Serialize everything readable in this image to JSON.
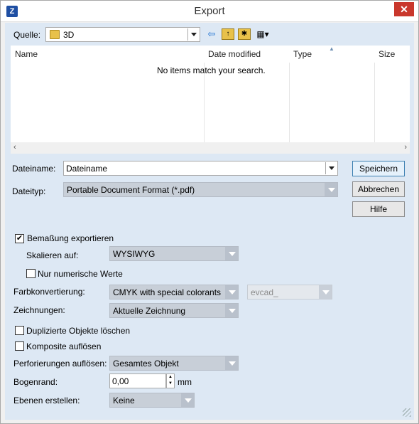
{
  "window": {
    "title": "Export",
    "close_label": "✕"
  },
  "location": {
    "label": "Quelle:",
    "value": "3D"
  },
  "listview": {
    "columns": [
      "Name",
      "Date modified",
      "Type",
      "Size"
    ],
    "empty_message": "No items match your search."
  },
  "file": {
    "name_label": "Dateiname:",
    "name_value": "Dateiname",
    "type_label": "Dateityp:",
    "type_value": "Portable Document Format (*.pdf)"
  },
  "buttons": {
    "save": "Speichern",
    "cancel": "Abbrechen",
    "help": "Hilfe"
  },
  "options": {
    "export_dimensions": {
      "label": "Bemaßung exportieren",
      "checked": true
    },
    "scale": {
      "label": "Skalieren auf:",
      "value": "WYSIWYG"
    },
    "numeric_only": {
      "label": "Nur numerische Werte",
      "checked": false
    },
    "color_conversion": {
      "label": "Farbkonvertierung:",
      "value": "CMYK with special colorants",
      "profile": "evcad_"
    },
    "drawings": {
      "label": "Zeichnungen:",
      "value": "Aktuelle Zeichnung"
    },
    "delete_duplicates": {
      "label": "Duplizierte Objekte löschen",
      "checked": false
    },
    "dissolve_composites": {
      "label": "Komposite auflösen",
      "checked": false
    },
    "perforations": {
      "label": "Perforierungen auflösen:",
      "value": "Gesamtes Objekt"
    },
    "arc_margin": {
      "label": "Bogenrand:",
      "value": "0,00",
      "unit": "mm"
    },
    "layers": {
      "label": "Ebenen erstellen:",
      "value": "Keine"
    }
  }
}
